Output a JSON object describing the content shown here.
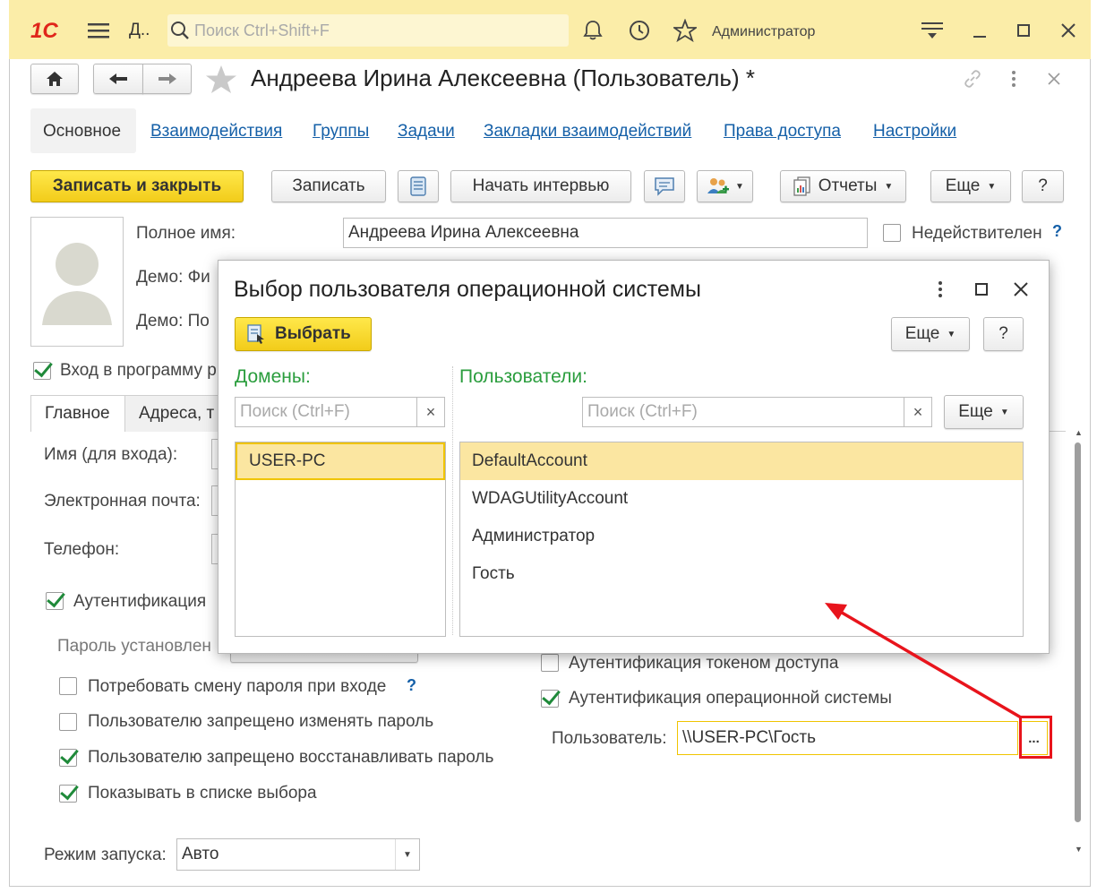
{
  "window": {
    "app_short": "Д..",
    "search_placeholder": "Поиск Ctrl+Shift+F",
    "user_name": "Администратор"
  },
  "form": {
    "title": "Андреева Ирина Алексеевна (Пользователь) *",
    "tabs": [
      "Основное",
      "Взаимодействия",
      "Группы",
      "Задачи",
      "Закладки взаимодействий",
      "Права доступа",
      "Настройки"
    ],
    "toolbar": {
      "save_close": "Записать и закрыть",
      "save": "Записать",
      "interview": "Начать интервью",
      "reports": "Отчеты",
      "more": "Еще",
      "help": "?"
    },
    "full_name_label": "Полное имя:",
    "full_name_value": "Андреева Ирина Алексеевна",
    "invalid_label": "Недействителен",
    "demo1_label": "Демо: Фи",
    "demo2_label": "Демо: По",
    "login_label": "Вход в программу р",
    "subtabs": [
      "Главное",
      "Адреса, т"
    ],
    "login_name_label": "Имя (для входа):",
    "email_label": "Электронная почта:",
    "phone_label": "Телефон:",
    "auth_label": "Аутентификация",
    "password_set_label": "Пароль установлен",
    "require_change": "Потребовать смену пароля при входе",
    "deny_change": "Пользователю запрещено изменять пароль",
    "deny_restore": "Пользователю запрещено восстанавливать пароль",
    "show_in_list": "Показывать в списке выбора",
    "launch_mode_label": "Режим запуска:",
    "launch_mode_value": "Авто",
    "token_auth": "Аутентификация токеном доступа",
    "os_auth": "Аутентификация операционной системы",
    "os_user_label": "Пользователь:",
    "os_user_value": "\\\\USER-PC\\Гость",
    "select_button": "..."
  },
  "dialog": {
    "title": "Выбор пользователя операционной системы",
    "select_label": "Выбрать",
    "more": "Еще",
    "help": "?",
    "domains_label": "Домены:",
    "users_label": "Пользователи:",
    "search_placeholder": "Поиск (Ctrl+F)",
    "clear": "×",
    "domains": [
      "USER-PC"
    ],
    "users": [
      "DefaultAccount",
      "WDAGUtilityAccount",
      "Администратор",
      "Гость"
    ]
  },
  "colors": {
    "titlebar": "#fbeda8",
    "accent_yellow": "#f4d02b",
    "link_blue": "#1560a8",
    "green_header": "#2a9d3d",
    "selection": "#fbe6a1",
    "annotation_red": "#e8141c"
  }
}
